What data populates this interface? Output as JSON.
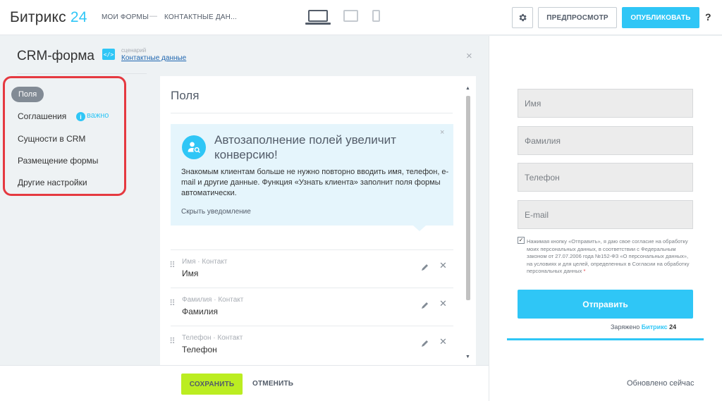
{
  "topbar": {
    "logo_main": "Битрикс",
    "logo_accent": "24",
    "breadcrumb": [
      "МОИ ФОРМЫ",
      "КОНТАКТНЫЕ ДАН..."
    ],
    "breadcrumb_sep": "—",
    "devices": [
      "laptop-icon",
      "tablet-icon",
      "phone-icon"
    ],
    "preview_label": "ПРЕДПРОСМОТР",
    "publish_label": "ОПУБЛИКОВАТЬ",
    "help_label": "?"
  },
  "panel": {
    "title": "CRM-форма",
    "scenario_icon": "</>",
    "scenario_caption": "сценарий",
    "scenario_link": "Контактные данные",
    "close": "×"
  },
  "nav": {
    "items": [
      {
        "label": "Поля"
      },
      {
        "label": "Соглашения"
      },
      {
        "label": "Сущности в CRM"
      },
      {
        "label": "Размещение формы"
      },
      {
        "label": "Другие настройки"
      }
    ],
    "info_badge": "i",
    "important_label": "важно"
  },
  "card": {
    "title": "Поля",
    "hint": {
      "title": "Автозаполнение полей увеличит конверсию!",
      "text": "Знакомым клиентам больше не нужно повторно вводить имя, телефон, e-mail и другие данные. Функция «Узнать клиента» заполнит поля формы автоматически.",
      "hide_link": "Скрыть уведомление",
      "close": "×"
    },
    "fields": [
      {
        "caption": "Имя · Контакт",
        "name": "Имя"
      },
      {
        "caption": "Фамилия · Контакт",
        "name": "Фамилия"
      },
      {
        "caption": "Телефон · Контакт",
        "name": "Телефон"
      }
    ],
    "drag_glyph": "⠿",
    "delete_glyph": "✕",
    "scroll_up": "▲",
    "scroll_down": "▼"
  },
  "bottombar": {
    "save_label": "СОХРАНИТЬ",
    "cancel_label": "ОТМЕНИТЬ"
  },
  "preview": {
    "inputs": [
      "Имя",
      "Фамилия",
      "Телефон",
      "E-mail"
    ],
    "checkmark": "✓",
    "consent_text": "Нажимая кнопку «Отправить», я даю свое согласие на обработку моих персональных данных, в соответствии с Федеральным законом от 27.07.2006 года №152-ФЗ «О персональных данных», на условиях и для целей, определенных в Согласии на обработку персональных данных",
    "consent_star": "*",
    "submit_label": "Отправить",
    "powered_prefix": "Заряжено",
    "powered_brand": "Битрикс",
    "powered_num": "24",
    "updated_label": "Обновлено сейчас"
  },
  "colors": {
    "accent": "#2fc6f6",
    "save": "#bbed21",
    "highlight": "#e53940"
  }
}
